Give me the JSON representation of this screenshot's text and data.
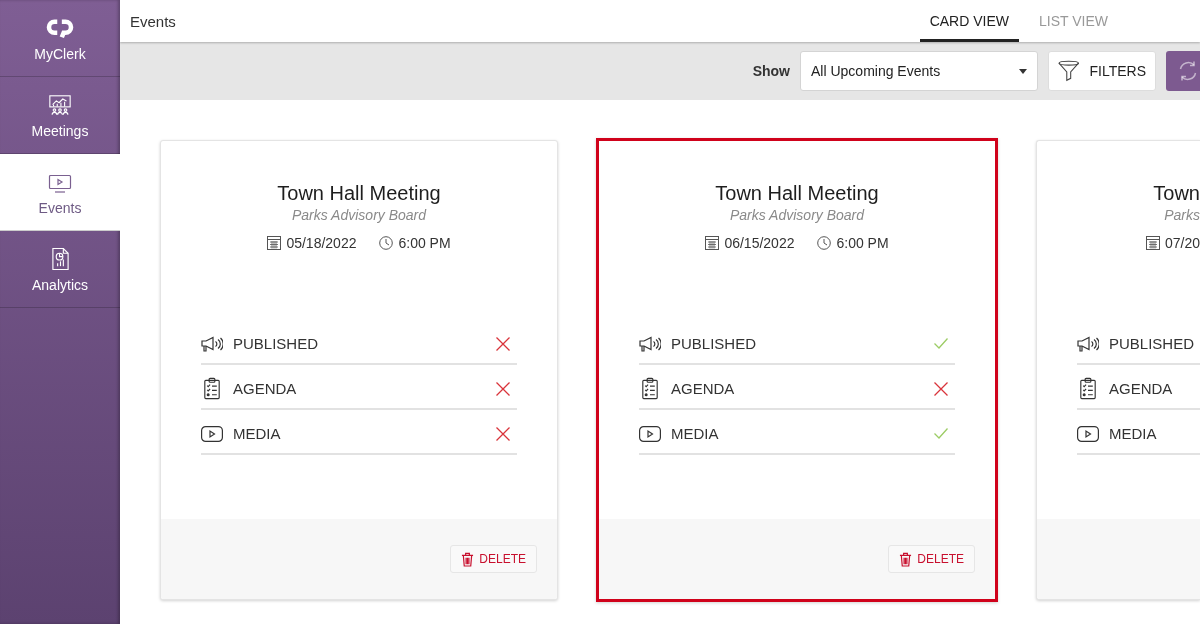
{
  "sidebar": {
    "items": [
      {
        "label": "MyClerk",
        "selected": false
      },
      {
        "label": "Meetings",
        "selected": false
      },
      {
        "label": "Events",
        "selected": true
      },
      {
        "label": "Analytics",
        "selected": false
      }
    ]
  },
  "header": {
    "title": "Events",
    "tabs": [
      {
        "label": "CARD VIEW",
        "selected": true
      },
      {
        "label": "LIST VIEW",
        "selected": false
      }
    ]
  },
  "toolbar": {
    "show_label": "Show",
    "dropdown": {
      "value": "All Upcoming Events"
    },
    "filters_button": "FILTERS"
  },
  "cards": [
    {
      "title": "Town Hall Meeting",
      "subtitle": "Parks Advisory Board",
      "date": "05/18/2022",
      "time": "6:00 PM",
      "selected": false,
      "checklist": [
        {
          "label": "PUBLISHED",
          "done": false
        },
        {
          "label": "AGENDA",
          "done": false
        },
        {
          "label": "MEDIA",
          "done": false
        }
      ],
      "delete_button": "DELETE"
    },
    {
      "title": "Town Hall Meeting",
      "subtitle": "Parks Advisory Board",
      "date": "06/15/2022",
      "time": "6:00 PM",
      "selected": true,
      "checklist": [
        {
          "label": "PUBLISHED",
          "done": true
        },
        {
          "label": "AGENDA",
          "done": false
        },
        {
          "label": "MEDIA",
          "done": true
        }
      ],
      "delete_button": "DELETE"
    },
    {
      "title": "Town",
      "subtitle": "Parks",
      "date": "07/20",
      "selected": false,
      "checklist": [
        {
          "label": "PUBLISHED"
        },
        {
          "label": "AGENDA"
        },
        {
          "label": "MEDIA"
        }
      ]
    }
  ]
}
